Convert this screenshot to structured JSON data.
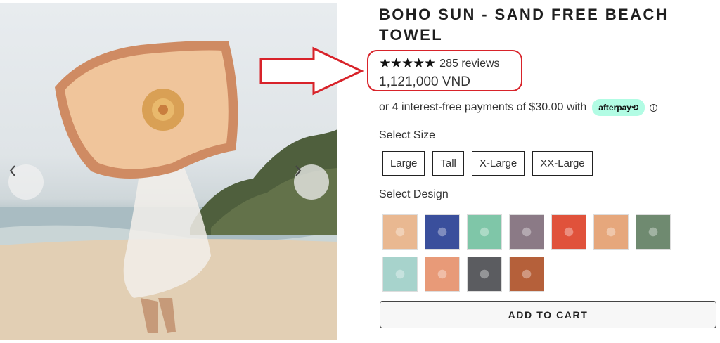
{
  "product": {
    "title": "BOHO SUN - SAND FREE BEACH TOWEL",
    "stars": "★★★★★",
    "reviews": "285 reviews",
    "price": "1,121,000 VND",
    "installment_text": "or 4 interest-free payments of $30.00 with",
    "afterpay_label": "afterpay⟲",
    "info_icon": "ⓘ"
  },
  "size": {
    "label": "Select Size",
    "options": [
      "Large",
      "Tall",
      "X-Large",
      "XX-Large"
    ]
  },
  "design": {
    "label": "Select Design",
    "swatch_colors": [
      "#e9b891",
      "#3a4f9c",
      "#7fc6a8",
      "#8b7a86",
      "#e0523b",
      "#e6a77c",
      "#6f8a70",
      "#a7d3cc",
      "#e89a78",
      "#5b5c60",
      "#b5603a"
    ]
  },
  "cart": {
    "label": "ADD TO CART"
  },
  "colors": {
    "annotation": "#d8232a",
    "afterpay": "#b2fce4"
  }
}
